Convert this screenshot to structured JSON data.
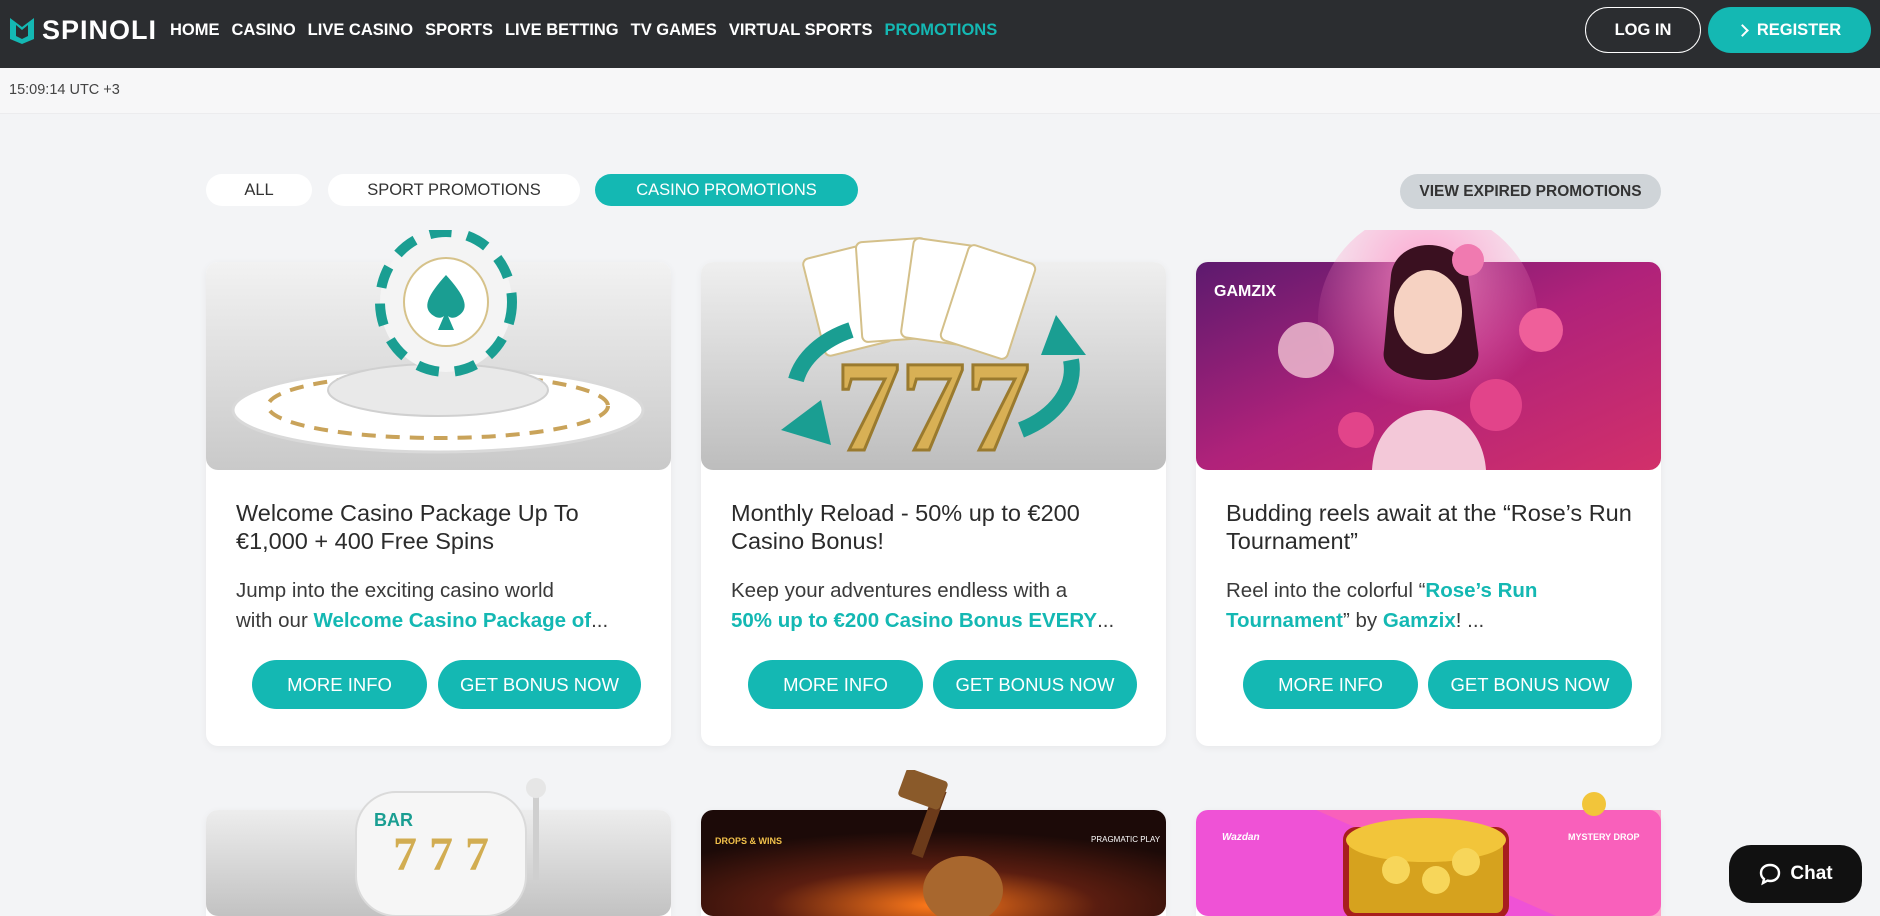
{
  "header": {
    "logo_text": "SPINOLI",
    "nav": [
      "HOME",
      "CASINO",
      "LIVE CASINO",
      "SPORTS",
      "LIVE BETTING",
      "TV GAMES",
      "VIRTUAL SPORTS",
      "PROMOTIONS"
    ],
    "active_nav": "PROMOTIONS",
    "login_label": "LOG IN",
    "register_label": "REGISTER"
  },
  "time": "15:09:14 UTC +3",
  "filters": {
    "all": "ALL",
    "sport": "SPORT PROMOTIONS",
    "casino": "CASINO PROMOTIONS",
    "active": "CASINO PROMOTIONS",
    "expired": "VIEW EXPIRED PROMOTIONS"
  },
  "cards": [
    {
      "title": "Welcome Casino Package Up To €1,000 + 400 Free Spins",
      "desc_line1": "Jump into the exciting casino world",
      "desc_line2_prefix": "with our ",
      "desc_line2_highlight": "Welcome Casino Package of",
      "desc_line2_suffix": "...",
      "more_label": "MORE INFO",
      "bonus_label": "GET BONUS NOW"
    },
    {
      "title": "Monthly Reload - 50% up to €200 Casino Bonus!",
      "desc_line1": "Keep your adventures endless with a",
      "desc_line2_prefix": " ",
      "desc_line2_highlight": "50% up to €200 Casino Bonus EVERY",
      "desc_line2_suffix": "...",
      "more_label": "MORE INFO",
      "bonus_label": "GET BONUS NOW"
    },
    {
      "title": "Budding reels await at the “Rose’s Run Tournament”",
      "desc_line1_prefix": "Reel into the colorful “",
      "desc_line1_highlight": "Rose’s Run",
      "desc_line2_highlight_a": "Tournament",
      "desc_line2_mid": "” by ",
      "desc_line2_highlight_b": "Gamzix",
      "desc_line2_suffix": "!  ...",
      "image_brand": "GAMZIX",
      "more_label": "MORE INFO",
      "bonus_label": "GET BONUS NOW"
    }
  ],
  "bottom_cards": {
    "slot_label": "BAR",
    "drops_badge": "DROPS & WINS",
    "pragmatic": "PRAGMATIC PLAY",
    "wazdan": "Wazdan",
    "mystery": "MYSTERY DROP"
  },
  "chat_label": "Chat",
  "colors": {
    "accent": "#14b8b3",
    "header_bg": "#2b2d30",
    "page_bg": "#f3f4f6"
  }
}
